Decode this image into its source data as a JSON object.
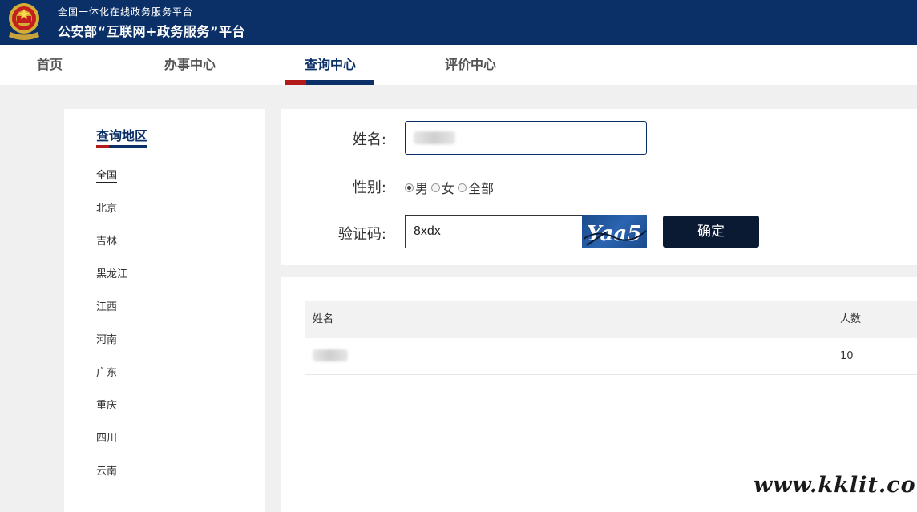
{
  "header": {
    "subtitle": "全国一体化在线政务服务平台",
    "title": "公安部“互联网+政务服务”平台"
  },
  "nav": {
    "items": [
      {
        "label": "首页"
      },
      {
        "label": "办事中心"
      },
      {
        "label": "查询中心",
        "active": true
      },
      {
        "label": "评价中心"
      }
    ]
  },
  "sidebar": {
    "title": "查询地区",
    "items": [
      "全国",
      "北京",
      "吉林",
      "黑龙江",
      "江西",
      "河南",
      "广东",
      "重庆",
      "四川",
      "云南"
    ],
    "active_index": 0
  },
  "form": {
    "name_label": "姓名:",
    "gender_label": "性别:",
    "gender_options": [
      "男",
      "女",
      "全部"
    ],
    "gender_selected": "男",
    "captcha_label": "验证码:",
    "captcha_value": "8xdx",
    "captcha_image_text": "Yaa5",
    "submit_label": "确定"
  },
  "results": {
    "columns": [
      "姓名",
      "人数"
    ],
    "rows": [
      {
        "count": "10"
      }
    ]
  },
  "watermark": "www.kklit.com",
  "colors": {
    "brand": "#0b3068",
    "accent_red": "#b31b1b",
    "button": "#0b1a33"
  }
}
